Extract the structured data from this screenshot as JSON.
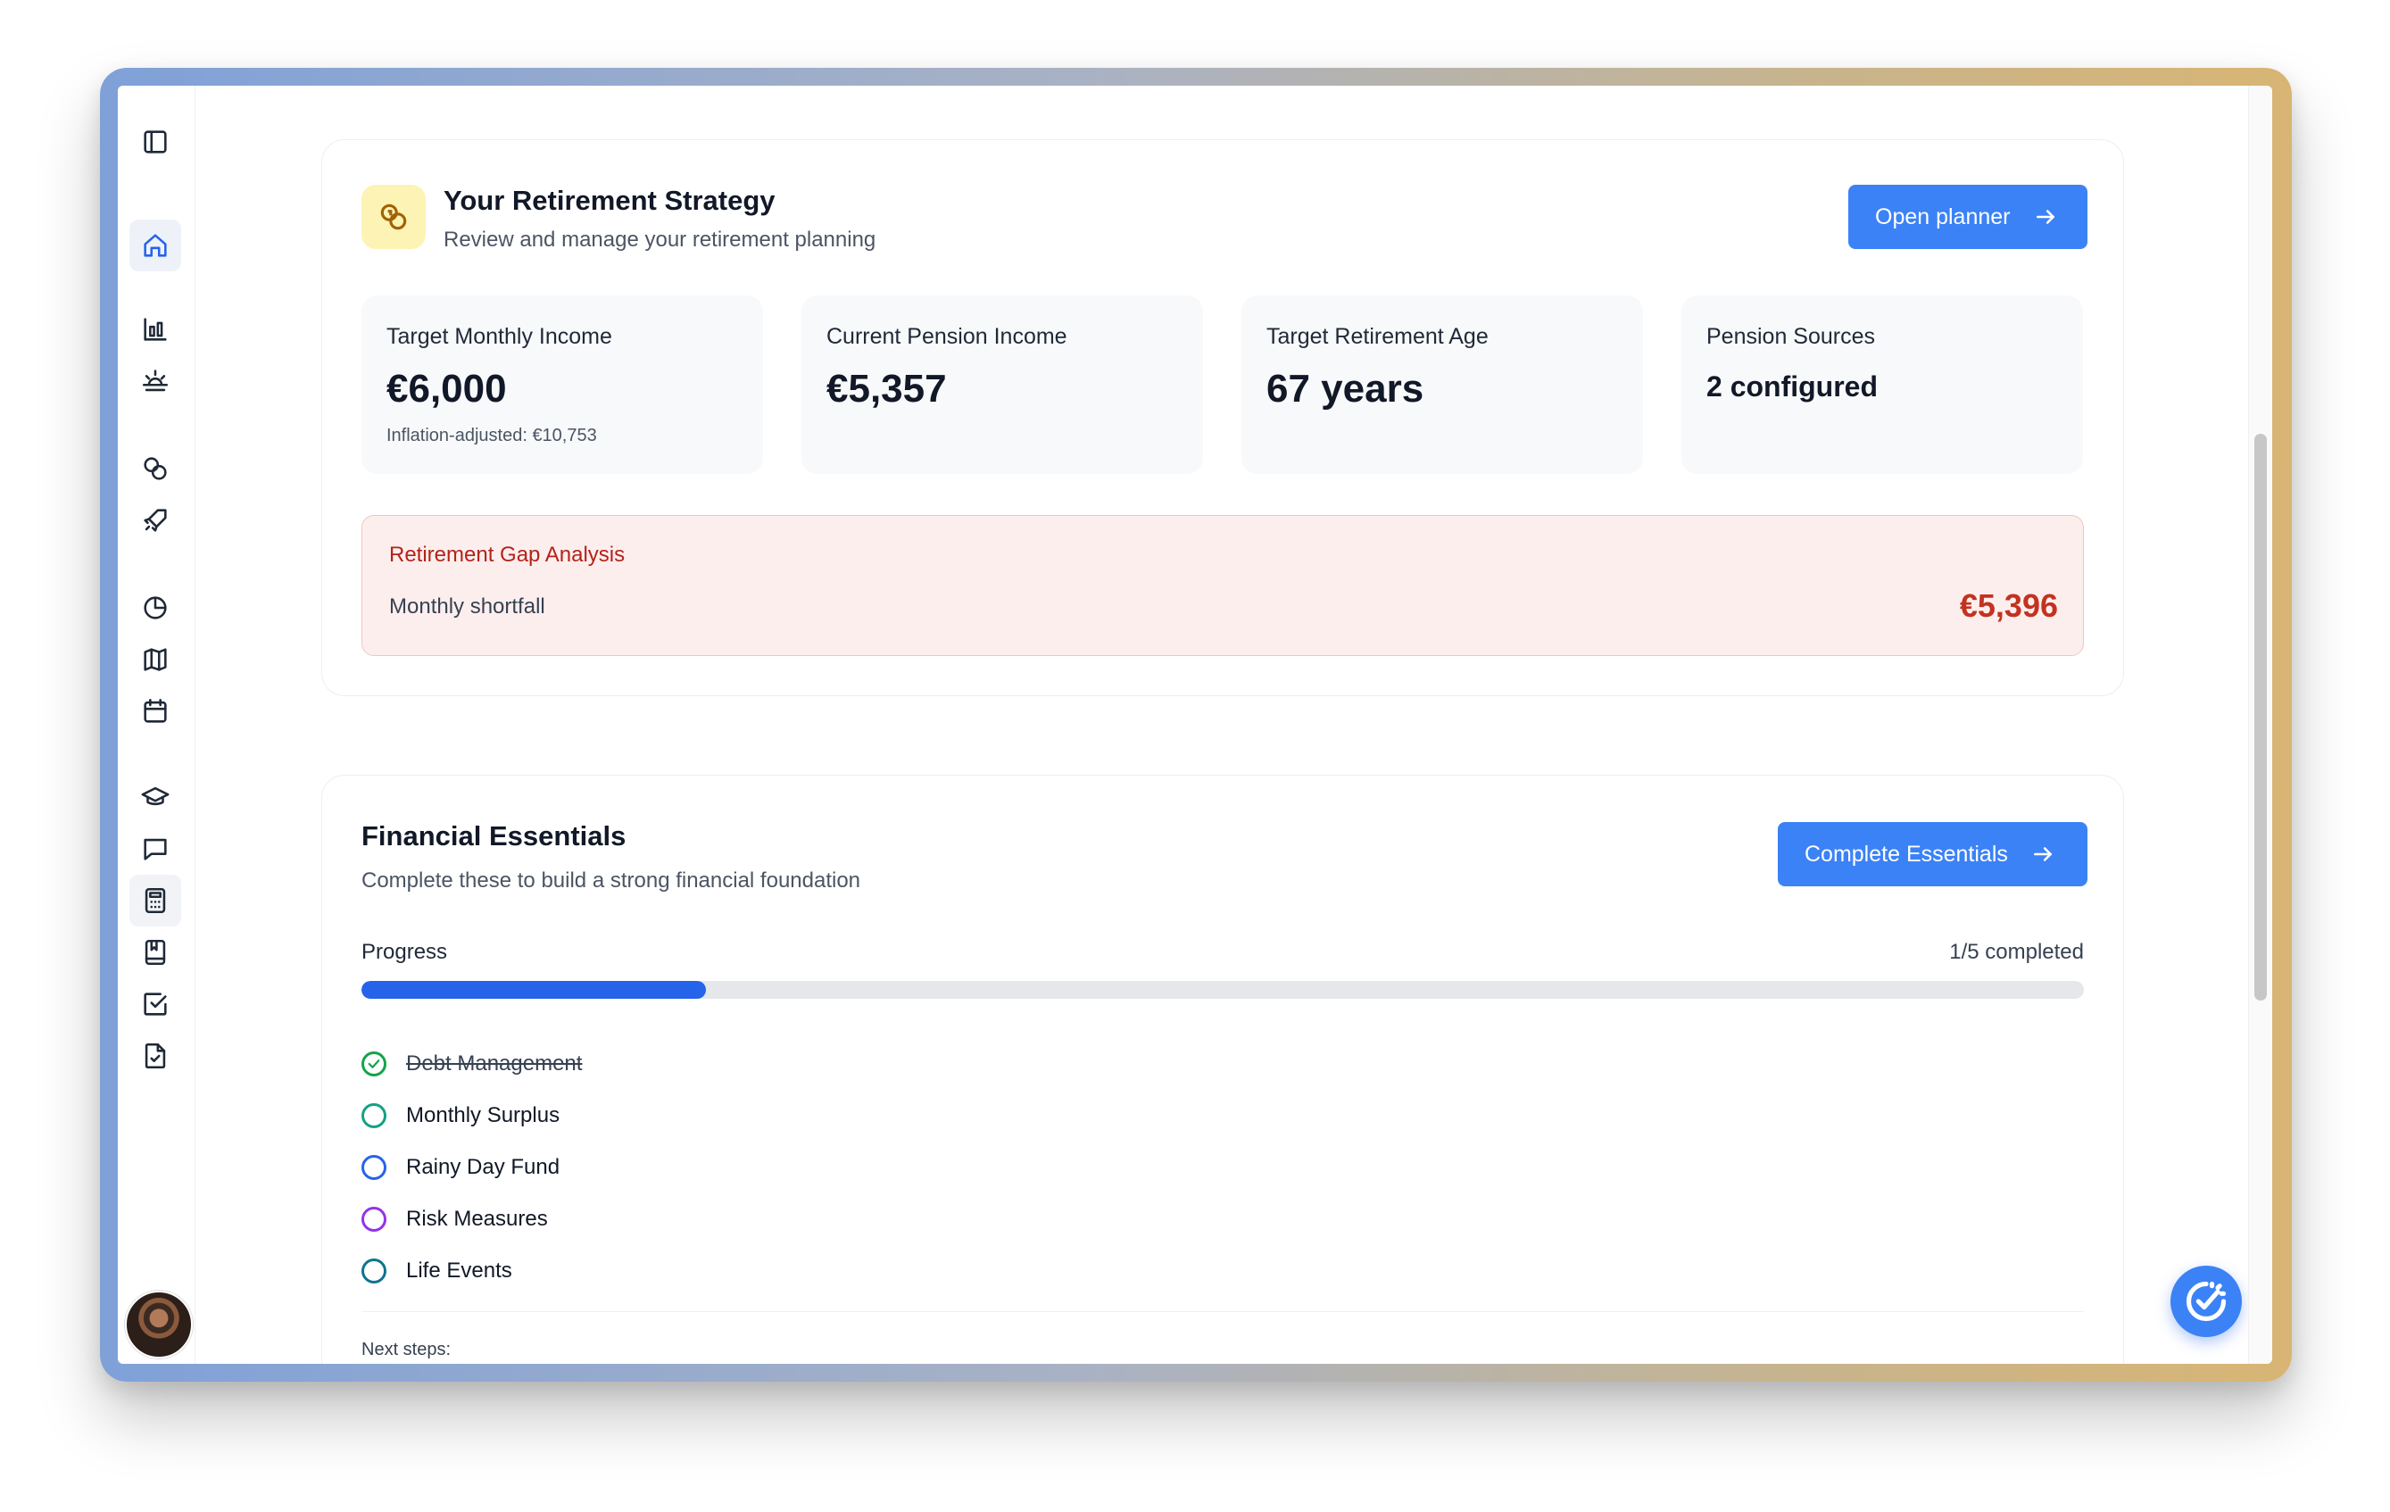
{
  "strategy": {
    "title": "Your Retirement Strategy",
    "subtitle": "Review and manage your retirement planning",
    "button_label": "Open planner",
    "stats": [
      {
        "label": "Target Monthly Income",
        "value": "€6,000",
        "note": "Inflation-adjusted: €10,753"
      },
      {
        "label": "Current Pension Income",
        "value": "€5,357"
      },
      {
        "label": "Target Retirement Age",
        "value": "67 years"
      },
      {
        "label": "Pension Sources",
        "value": "2 configured"
      }
    ],
    "gap": {
      "title": "Retirement Gap Analysis",
      "label": "Monthly shortfall",
      "value": "€5,396"
    }
  },
  "essentials": {
    "title": "Financial Essentials",
    "subtitle": "Complete these to build a strong financial foundation",
    "button_label": "Complete Essentials",
    "progress_label": "Progress",
    "progress_count": "1/5 completed",
    "progress_fraction": 0.2,
    "items": [
      {
        "label": "Debt Management",
        "done": true,
        "color": "#16a34a"
      },
      {
        "label": "Monthly Surplus",
        "done": false,
        "color": "#16a085"
      },
      {
        "label": "Rainy Day Fund",
        "done": false,
        "color": "#2563eb"
      },
      {
        "label": "Risk Measures",
        "done": false,
        "color": "#9333ea"
      },
      {
        "label": "Life Events",
        "done": false,
        "color": "#0e7490"
      }
    ],
    "next_steps_label": "Next steps:"
  },
  "colors": {
    "accent": "#3b82f6",
    "danger": "#c2331f"
  }
}
